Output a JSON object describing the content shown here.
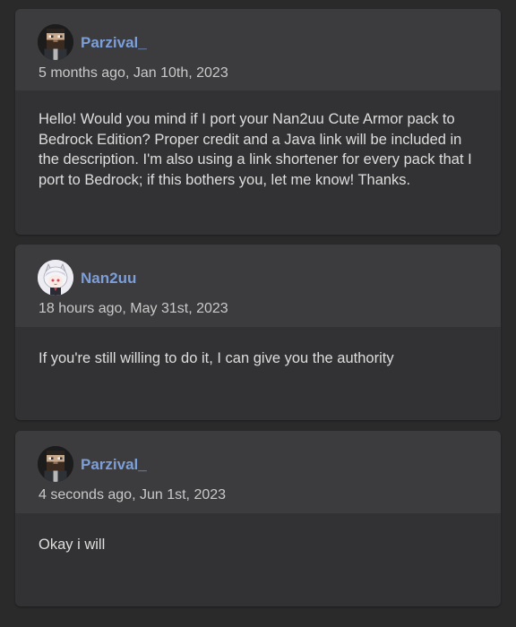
{
  "comments": [
    {
      "username": "Parzival_",
      "avatar_icon": "pixel-avatar-bearded-icon",
      "timestamp": "5 months ago, Jan 10th, 2023",
      "body": "Hello! Would you mind if I port your Nan2uu Cute Armor pack to Bedrock Edition? Proper credit and a Java link will be included in the description. I'm also using a link shortener for every pack that I port to Bedrock; if this bothers you, let me know! Thanks."
    },
    {
      "username": "Nan2uu",
      "avatar_icon": "anime-girl-avatar-icon",
      "timestamp": "18 hours ago, May 31st, 2023",
      "body": "If you're still willing to do it, I can give you the authority"
    },
    {
      "username": "Parzival_",
      "avatar_icon": "pixel-avatar-bearded-icon",
      "timestamp": "4 seconds ago, Jun 1st, 2023",
      "body": "Okay i will"
    }
  ],
  "colors": {
    "page_background": "#2a2a2b",
    "card_background": "#323234",
    "header_background": "#3c3c3e",
    "username": "#7c9ed9",
    "timestamp": "#c9c9c9",
    "body_text": "#dedede"
  }
}
